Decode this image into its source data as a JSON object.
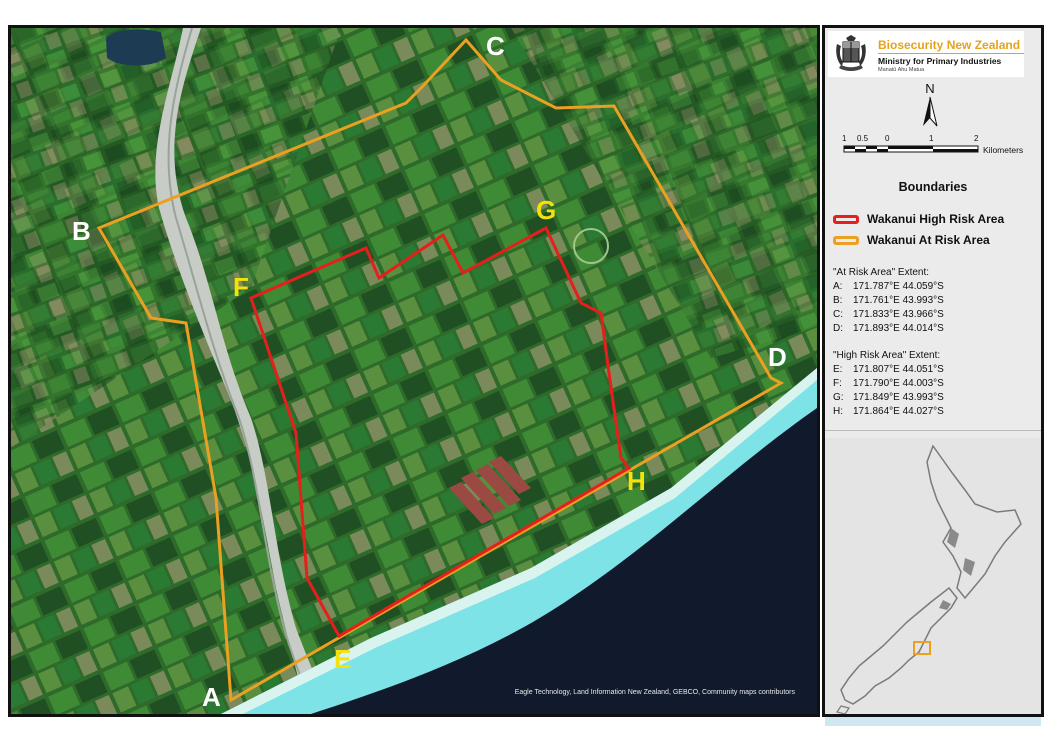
{
  "map": {
    "attribution": "Eagle Technology, Land Information New Zealand, GEBCO, Community maps contributors",
    "point_labels": {
      "A": "A",
      "B": "B",
      "C": "C",
      "D": "D",
      "E": "E",
      "F": "F",
      "G": "G",
      "H": "H"
    },
    "colors": {
      "high_risk": "#e5201c",
      "at_risk": "#eba022",
      "sea": "#101a2c",
      "surf": "#7ee3e6",
      "land": "#2f6b2a"
    }
  },
  "header": {
    "org_name": "Biosecurity New Zealand",
    "ministry": "Ministry for Primary Industries",
    "maori_name": "Manatū Ahu Matua"
  },
  "north_arrow": {
    "label": "N"
  },
  "scale_bar": {
    "ticks": [
      "1",
      "0.5",
      "0",
      "1",
      "2"
    ],
    "unit": "Kilometers"
  },
  "legend": {
    "title": "Boundaries",
    "items": [
      {
        "label": "Wakanui High Risk Area",
        "color": "#e5201c"
      },
      {
        "label": "Wakanui At Risk Area",
        "color": "#eba022"
      }
    ]
  },
  "extents": {
    "at_risk_title": "\"At Risk Area\" Extent:",
    "at_risk": [
      {
        "letter": "A:",
        "coords": "171.787°E 44.059°S"
      },
      {
        "letter": "B:",
        "coords": "171.761°E 43.993°S"
      },
      {
        "letter": "C:",
        "coords": "171.833°E 43.966°S"
      },
      {
        "letter": "D:",
        "coords": "171.893°E 44.014°S"
      }
    ],
    "high_risk_title": "\"High Risk Area\" Extent:",
    "high_risk": [
      {
        "letter": "E:",
        "coords": "171.807°E 44.051°S"
      },
      {
        "letter": "F:",
        "coords": "171.790°E 44.003°S"
      },
      {
        "letter": "G:",
        "coords": "171.849°E 43.993°S"
      },
      {
        "letter": "H:",
        "coords": "171.864°E 44.027°S"
      }
    ]
  },
  "inset": {
    "land_color": "#8a8a8a",
    "highlight_color": "#eba022"
  }
}
